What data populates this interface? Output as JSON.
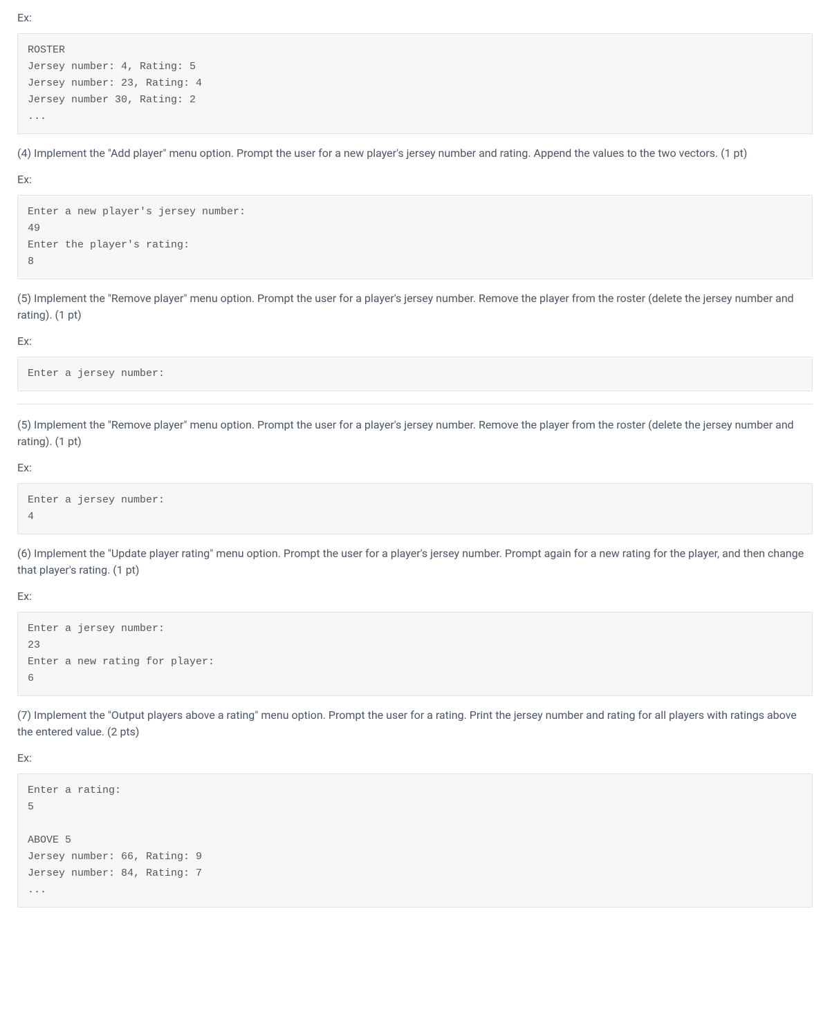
{
  "section0": {
    "ex_label": "Ex:",
    "code": "ROSTER\nJersey number: 4, Rating: 5\nJersey number: 23, Rating: 4\nJersey number 30, Rating: 2\n..."
  },
  "section4": {
    "desc": "(4) Implement the \"Add player\" menu option. Prompt the user for a new player's jersey number and rating. Append the values to the two vectors. (1 pt)",
    "ex_label": "Ex:",
    "code": "Enter a new player's jersey number:\n49\nEnter the player's rating:\n8"
  },
  "section5a": {
    "desc": "(5) Implement the \"Remove player\" menu option. Prompt the user for a player's jersey number. Remove the player from the roster (delete the jersey number and rating). (1 pt)",
    "ex_label": "Ex:",
    "code": "Enter a jersey number:"
  },
  "section5b": {
    "desc": "(5) Implement the \"Remove player\" menu option. Prompt the user for a player's jersey number. Remove the player from the roster (delete the jersey number and rating). (1 pt)",
    "ex_label": "Ex:",
    "code": "Enter a jersey number:\n4"
  },
  "section6": {
    "desc": "(6) Implement the \"Update player rating\" menu option. Prompt the user for a player's jersey number. Prompt again for a new rating for the player, and then change that player's rating. (1 pt)",
    "ex_label": "Ex:",
    "code": "Enter a jersey number:\n23\nEnter a new rating for player:\n6"
  },
  "section7": {
    "desc": "(7) Implement the \"Output players above a rating\" menu option. Prompt the user for a rating. Print the jersey number and rating for all players with ratings above the entered value. (2 pts)",
    "ex_label": "Ex:",
    "code": "Enter a rating:\n5\n\nABOVE 5\nJersey number: 66, Rating: 9\nJersey number: 84, Rating: 7\n..."
  }
}
